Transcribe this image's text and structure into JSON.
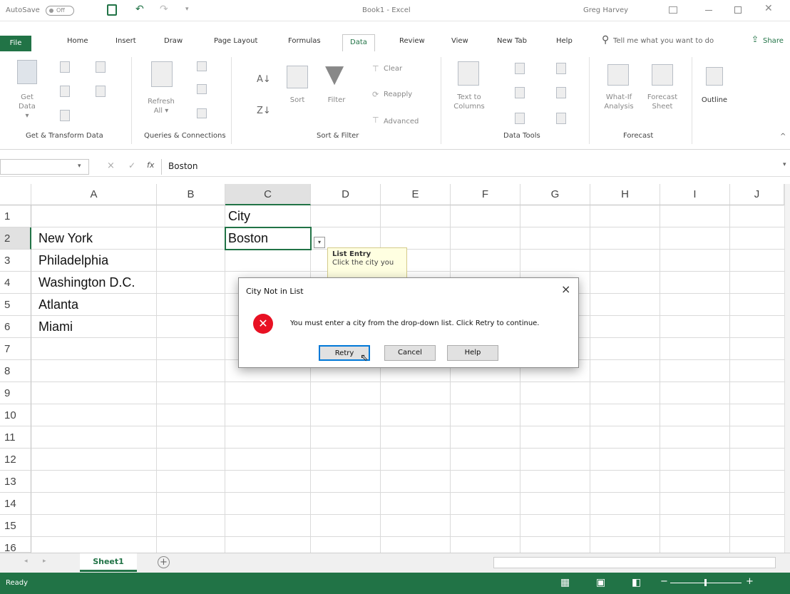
{
  "titlebar": {
    "autosave_label": "AutoSave",
    "autosave_state": "Off",
    "document_title": "Book1 - Excel",
    "user_name": "Greg Harvey"
  },
  "tabs": [
    "File",
    "Home",
    "Insert",
    "Draw",
    "Page Layout",
    "Formulas",
    "Data",
    "Review",
    "View",
    "New Tab",
    "Help"
  ],
  "active_tab": "Data",
  "search_placeholder": "Tell me what you want to do",
  "share_label": "Share",
  "ribbon": {
    "get_data": "Get Data",
    "get_data_caret": "▾",
    "refresh_all": "Refresh All",
    "refresh_caret": "▾",
    "sort": "Sort",
    "filter": "Filter",
    "clear": "Clear",
    "reapply": "Reapply",
    "advanced": "Advanced",
    "text_to_columns": "Text to Columns",
    "what_if": "What-If Analysis",
    "forecast_sheet": "Forecast Sheet",
    "outline": "Outline",
    "groups": [
      "Get & Transform Data",
      "Queries & Connections",
      "Sort & Filter",
      "Data Tools",
      "Forecast"
    ]
  },
  "formula_bar": {
    "fx": "fx",
    "cancel": "×",
    "enter": "✓",
    "value": "Boston"
  },
  "columns": [
    "A",
    "B",
    "C",
    "D",
    "E",
    "F",
    "G",
    "H",
    "I",
    "J"
  ],
  "rows": [
    "1",
    "2",
    "3",
    "4",
    "5",
    "6",
    "7",
    "8",
    "9",
    "10",
    "11",
    "12",
    "13",
    "14",
    "15",
    "16"
  ],
  "cells": {
    "C1": "City",
    "A2": "New York",
    "C2": "Boston",
    "A3": "Philadelphia",
    "A4": "Washington D.C.",
    "A5": "Atlanta",
    "A6": "Miami"
  },
  "tooltip": {
    "title": "List Entry",
    "text": "Click the city you"
  },
  "dialog": {
    "title": "City Not in List",
    "message": "You must enter a city from the drop-down list. Click Retry to continue.",
    "retry": "Retry",
    "cancel": "Cancel",
    "help": "Help",
    "close": "×"
  },
  "sheet_tab": "Sheet1",
  "add_sheet": "+",
  "status": "Ready",
  "colors": {
    "excel_green": "#217346",
    "error_red": "#e81123"
  }
}
